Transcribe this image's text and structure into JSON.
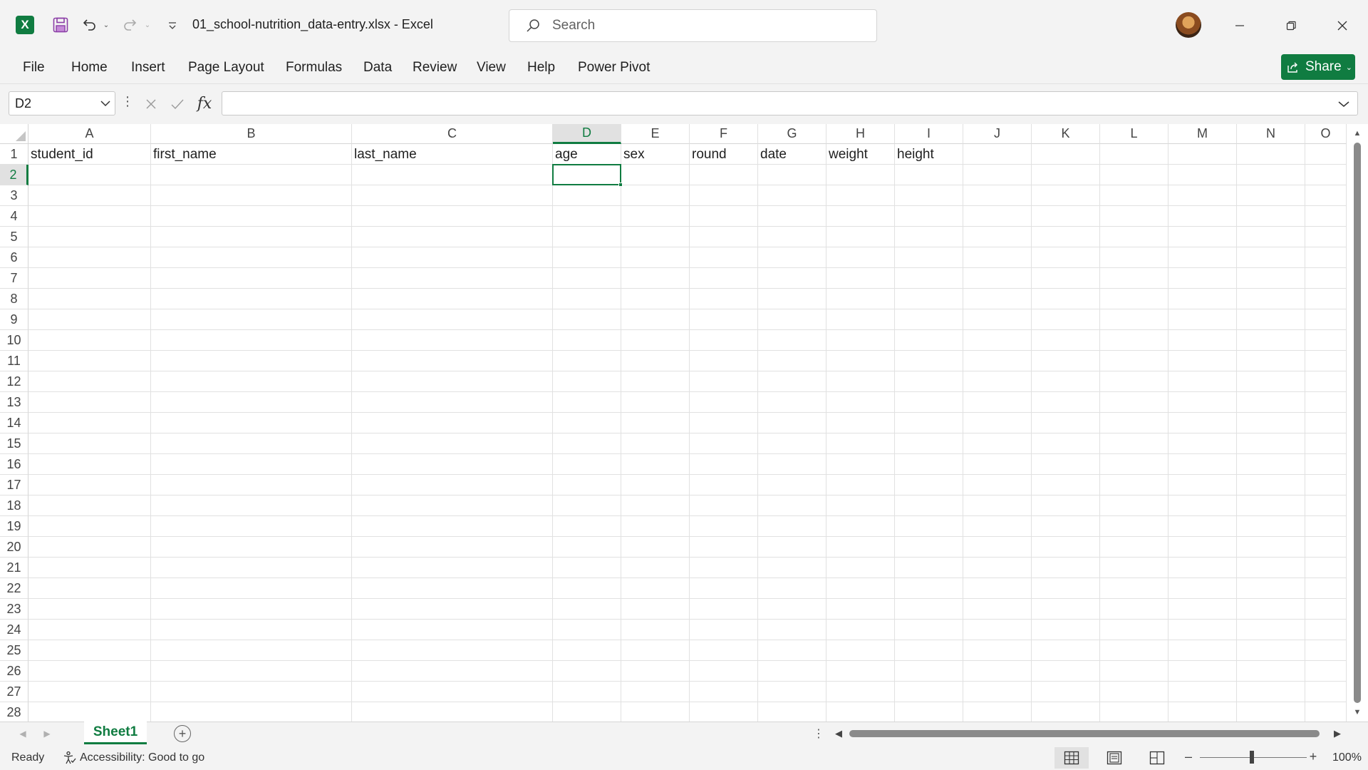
{
  "app": {
    "logo_letter": "X",
    "document_title": "01_school-nutrition_data-entry.xlsx  -  Excel",
    "search_placeholder": "Search"
  },
  "ribbon": {
    "tabs": [
      "File",
      "Home",
      "Insert",
      "Page Layout",
      "Formulas",
      "Data",
      "Review",
      "View",
      "Help",
      "Power Pivot"
    ],
    "share_label": "Share"
  },
  "formula_bar": {
    "name_box": "D2",
    "fx_label": "fx",
    "formula": ""
  },
  "grid": {
    "columns": [
      "A",
      "B",
      "C",
      "D",
      "E",
      "F",
      "G",
      "H",
      "I",
      "J",
      "K",
      "L",
      "M",
      "N",
      "O"
    ],
    "rows": [
      "1",
      "2",
      "3",
      "4",
      "5",
      "6",
      "7",
      "8",
      "9",
      "10",
      "11",
      "12",
      "13",
      "14",
      "15",
      "16",
      "17",
      "18",
      "19",
      "20",
      "21",
      "22",
      "23",
      "24",
      "25",
      "26",
      "27",
      "28"
    ],
    "row1_values": [
      "student_id",
      "first_name",
      "last_name",
      "age",
      "sex",
      "round",
      "date",
      "weight",
      "height",
      "",
      "",
      "",
      "",
      "",
      ""
    ],
    "selected_cell": "D2",
    "selected_column": "D",
    "selected_row": "2"
  },
  "sheets": {
    "tabs": [
      "Sheet1"
    ],
    "active": "Sheet1"
  },
  "status": {
    "ready": "Ready",
    "accessibility": "Accessibility: Good to go",
    "zoom": "100%",
    "zoom_percent": 100
  },
  "colors": {
    "accent": "#107c41",
    "chrome": "#f3f3f3",
    "gridline": "#e1e1e1"
  },
  "icons": [
    "excel-logo-icon",
    "save-icon",
    "undo-icon",
    "redo-icon",
    "customize-qat-icon",
    "search-icon",
    "avatar",
    "minimize-icon",
    "restore-icon",
    "close-icon",
    "share-icon",
    "cancel-icon",
    "enter-icon",
    "function-icon",
    "accessibility-icon",
    "normal-view-icon",
    "page-layout-view-icon",
    "page-break-view-icon"
  ]
}
